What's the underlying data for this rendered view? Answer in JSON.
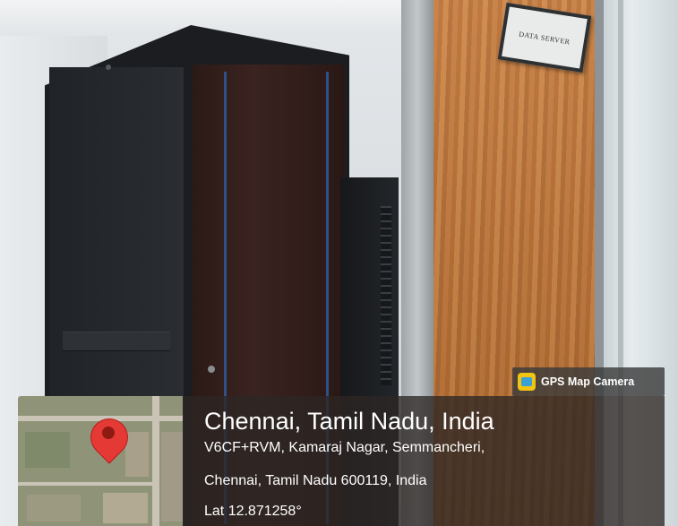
{
  "photo": {
    "door_sign_text": "DATA SERVER"
  },
  "overlay": {
    "badge": {
      "icon": "gps-map-camera-icon",
      "label": "GPS Map Camera"
    },
    "map": {
      "pin_icon": "location-pin-icon",
      "pin_color": "#e53935"
    },
    "location": {
      "title": "Chennai, Tamil Nadu, India",
      "address_line_1": "V6CF+RVM, Kamaraj Nagar, Semmancheri,",
      "address_line_2": "Chennai, Tamil Nadu 600119, India",
      "coordinates": "Lat 12.871258°"
    }
  }
}
